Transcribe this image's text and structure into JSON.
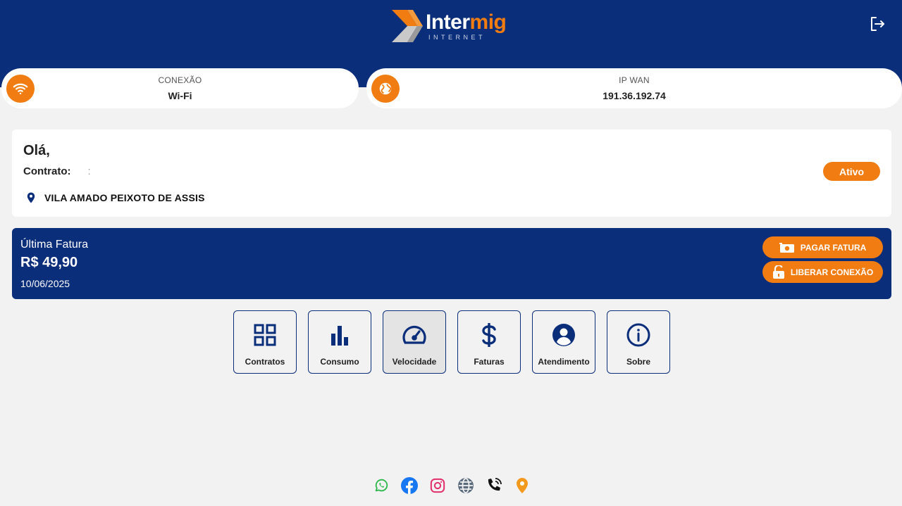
{
  "header": {
    "brand_part1": "Inter",
    "brand_part2": "mig",
    "brand_sub": "INTERNET"
  },
  "connection": {
    "label": "CONEXÃO",
    "value": "Wi-Fi"
  },
  "wan": {
    "label": "IP WAN",
    "value": "191.36.192.74"
  },
  "user": {
    "greeting": "Olá,",
    "contract_label": "Contrato:",
    "contract_value": ":",
    "address": "VILA AMADO PEIXOTO DE ASSIS",
    "status": "Ativo"
  },
  "invoice": {
    "title": "Última Fatura",
    "amount": "R$ 49,90",
    "date": "10/06/2025",
    "pay_label": "PAGAR FATURA",
    "unlock_label": "LIBERAR CONEXÃO"
  },
  "menu": [
    {
      "label": "Contratos",
      "icon": "grid-icon"
    },
    {
      "label": "Consumo",
      "icon": "bar-chart-icon"
    },
    {
      "label": "Velocidade",
      "icon": "speedometer-icon",
      "active": true
    },
    {
      "label": "Faturas",
      "icon": "dollar-icon"
    },
    {
      "label": "Atendimento",
      "icon": "user-circle-icon"
    },
    {
      "label": "Sobre",
      "icon": "info-icon"
    }
  ],
  "social": [
    "whatsapp-icon",
    "facebook-icon",
    "instagram-icon",
    "globe-icon",
    "phone-icon",
    "location-icon"
  ],
  "colors": {
    "primary": "#0b2e7a",
    "accent": "#f07c12",
    "background": "#f2f2f2"
  }
}
